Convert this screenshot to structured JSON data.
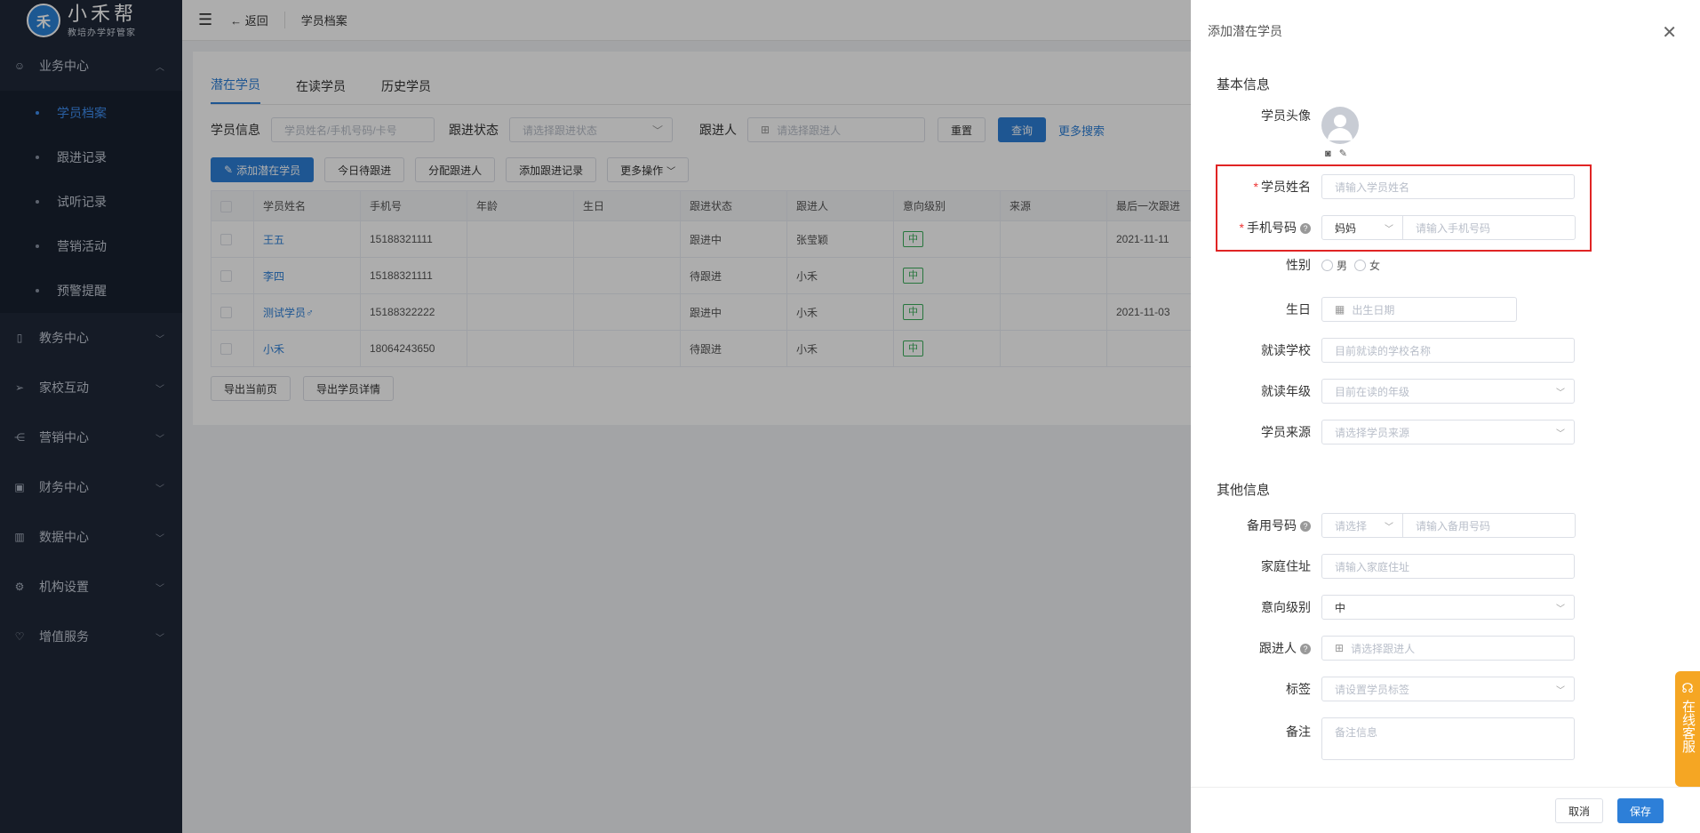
{
  "logo": {
    "mark": "禾",
    "title": "小禾帮",
    "subtitle": "教培办学好管家"
  },
  "sidebar": {
    "groups": [
      {
        "label": "业务中心",
        "icon": "user-icon",
        "open": true,
        "items": [
          "学员档案",
          "跟进记录",
          "试听记录",
          "营销活动",
          "预警提醒"
        ]
      },
      {
        "label": "教务中心",
        "icon": "book-icon"
      },
      {
        "label": "家校互动",
        "icon": "send-icon"
      },
      {
        "label": "营销中心",
        "icon": "share-icon"
      },
      {
        "label": "财务中心",
        "icon": "wallet-icon"
      },
      {
        "label": "数据中心",
        "icon": "chart-icon"
      },
      {
        "label": "机构设置",
        "icon": "gear-icon"
      },
      {
        "label": "增值服务",
        "icon": "heart-icon"
      }
    ],
    "active_item": "学员档案"
  },
  "topbar": {
    "back": "返回",
    "breadcrumb": "学员档案"
  },
  "tabs": [
    "潜在学员",
    "在读学员",
    "历史学员"
  ],
  "filters": {
    "student_label": "学员信息",
    "student_placeholder": "学员姓名/手机号码/卡号",
    "status_label": "跟进状态",
    "status_placeholder": "请选择跟进状态",
    "follower_label": "跟进人",
    "follower_placeholder": "请选择跟进人",
    "reset": "重置",
    "query": "查询",
    "more_search": "更多搜索"
  },
  "actions": {
    "add": "添加潜在学员",
    "today": "今日待跟进",
    "assign": "分配跟进人",
    "add_record": "添加跟进记录",
    "more": "更多操作"
  },
  "table": {
    "headers": [
      "学员姓名",
      "手机号",
      "年龄",
      "生日",
      "跟进状态",
      "跟进人",
      "意向级别",
      "来源",
      "最后一次跟进"
    ],
    "rows": [
      {
        "name": "王五",
        "phone": "15188321111",
        "age": "",
        "birthday": "",
        "status": "跟进中",
        "follower": "张莹颖",
        "level": "中",
        "source": "",
        "last": "2021-11-11"
      },
      {
        "name": "李四",
        "phone": "15188321111",
        "age": "",
        "birthday": "",
        "status": "待跟进",
        "follower": "小禾",
        "level": "中",
        "source": "",
        "last": ""
      },
      {
        "name": "测试学员♂",
        "phone": "15188322222",
        "age": "",
        "birthday": "",
        "status": "跟进中",
        "follower": "小禾",
        "level": "中",
        "source": "",
        "last": "2021-11-03"
      },
      {
        "name": "小禾",
        "phone": "18064243650",
        "age": "",
        "birthday": "",
        "status": "待跟进",
        "follower": "小禾",
        "level": "中",
        "source": "",
        "last": ""
      }
    ]
  },
  "export": {
    "current": "导出当前页",
    "detail": "导出学员详情"
  },
  "drawer": {
    "title": "添加潜在学员",
    "basic_title": "基本信息",
    "other_title": "其他信息",
    "avatar_label": "学员头像",
    "name_label": "学员姓名",
    "name_placeholder": "请输入学员姓名",
    "phone_label": "手机号码",
    "phone_relation": "妈妈",
    "phone_placeholder": "请输入手机号码",
    "gender_label": "性别",
    "gender_male": "男",
    "gender_female": "女",
    "birthday_label": "生日",
    "birthday_placeholder": "出生日期",
    "school_label": "就读学校",
    "school_placeholder": "目前就读的学校名称",
    "grade_label": "就读年级",
    "grade_placeholder": "目前在读的年级",
    "source_label": "学员来源",
    "source_placeholder": "请选择学员来源",
    "backup_label": "备用号码",
    "backup_select": "请选择",
    "backup_placeholder": "请输入备用号码",
    "address_label": "家庭住址",
    "address_placeholder": "请输入家庭住址",
    "intent_label": "意向级别",
    "intent_value": "中",
    "follower_label": "跟进人",
    "follower_placeholder": "请选择跟进人",
    "tag_label": "标签",
    "tag_placeholder": "请设置学员标签",
    "remark_label": "备注",
    "remark_placeholder": "备注信息",
    "cancel": "取消",
    "save": "保存"
  },
  "kefu": "在线客服",
  "colors": {
    "primary": "#2d7fd8",
    "sidebar": "#1f2838",
    "highlight": "#e02424",
    "kefu": "#f5a623"
  }
}
